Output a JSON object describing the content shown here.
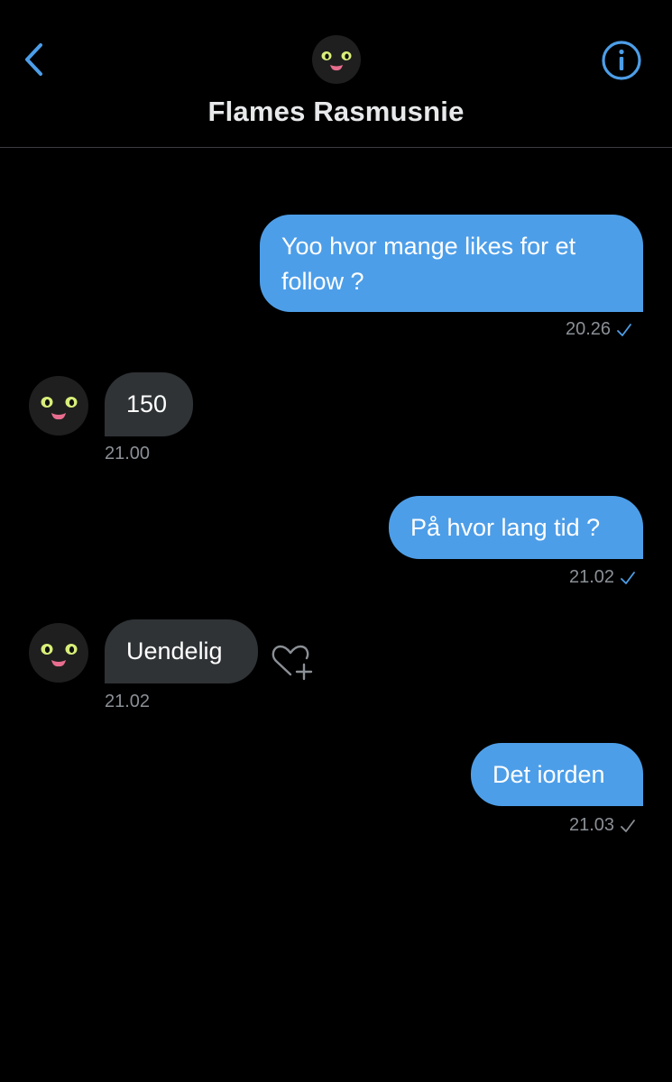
{
  "header": {
    "title": "Flames Rasmusnie",
    "back_icon": "chevron-left-icon",
    "info_icon": "info-icon"
  },
  "colors": {
    "accent": "#4d9ee8",
    "outgoing_bubble": "#4d9ee8",
    "incoming_bubble": "#2f3336",
    "meta_text": "#8b9096",
    "background": "#000000"
  },
  "messages": [
    {
      "direction": "out",
      "text": "Yoo hvor mange likes for et follow ?",
      "time": "20.26",
      "status": "read"
    },
    {
      "direction": "in",
      "text": "150",
      "time": "21.00"
    },
    {
      "direction": "out",
      "text": "På hvor lang tid ?",
      "time": "21.02",
      "status": "read"
    },
    {
      "direction": "in",
      "text": "Uendelig",
      "time": "21.02",
      "reaction_icon": "heart-plus-icon"
    },
    {
      "direction": "out",
      "text": "Det iorden",
      "time": "21.03",
      "status": "sent"
    }
  ]
}
